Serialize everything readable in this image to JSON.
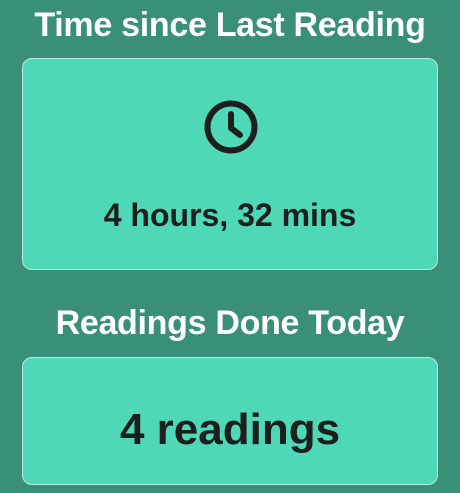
{
  "last_reading": {
    "title": "Time since Last Reading",
    "icon": "clock-icon",
    "value": "4 hours, 32 mins"
  },
  "today": {
    "title": "Readings Done Today",
    "value": "4 readings"
  },
  "colors": {
    "background": "#3a8f78",
    "card": "#4fd8b6",
    "card_border": "#b9ece0",
    "text_dark": "#1c1f1e",
    "text_light": "#ffffff"
  }
}
